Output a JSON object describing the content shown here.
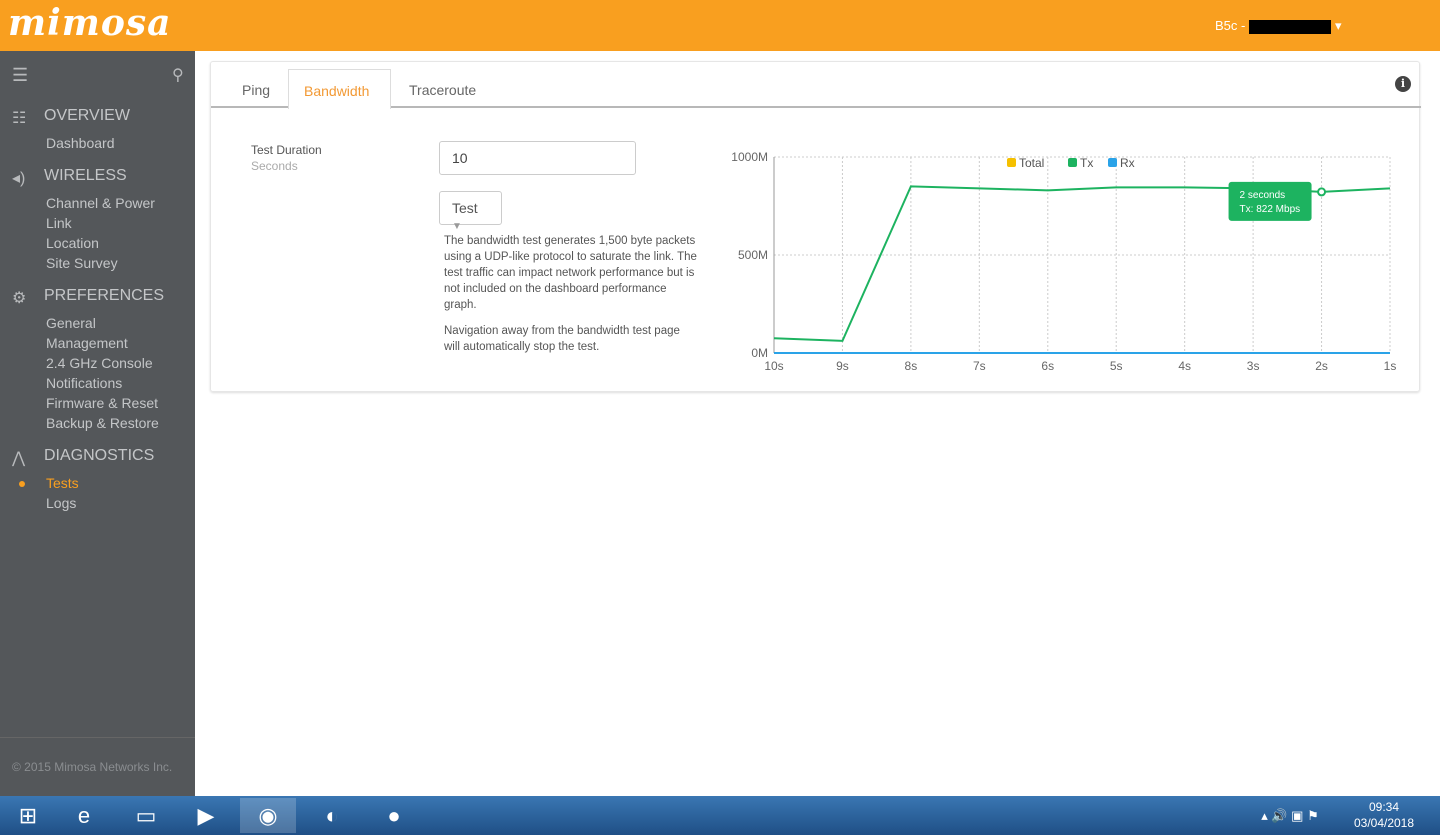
{
  "header": {
    "logo": "mimosa",
    "device": "B5c -"
  },
  "sidebar": {
    "sections": [
      {
        "title": "OVERVIEW",
        "items": [
          "Dashboard"
        ]
      },
      {
        "title": "WIRELESS",
        "items": [
          "Channel & Power",
          "Link",
          "Location",
          "Site Survey"
        ]
      },
      {
        "title": "PREFERENCES",
        "items": [
          "General",
          "Management",
          "2.4 GHz Console",
          "Notifications",
          "Firmware & Reset",
          "Backup & Restore"
        ]
      },
      {
        "title": "DIAGNOSTICS",
        "items": [
          "Tests",
          "Logs"
        ]
      }
    ],
    "active": "Tests",
    "footer": "© 2015 Mimosa Networks Inc."
  },
  "tabs": [
    "Ping",
    "Bandwidth",
    "Traceroute"
  ],
  "form": {
    "label": "Test Duration",
    "sublabel": "Seconds",
    "value": "10",
    "button": "Test",
    "desc1": "The bandwidth test generates 1,500 byte packets using a UDP-like protocol to saturate the link. The test traffic can impact network performance but is not included on the dashboard performance graph.",
    "desc2": "Navigation away from the bandwidth test page will automatically stop the test."
  },
  "chart_data": {
    "type": "line",
    "x": [
      "10s",
      "9s",
      "8s",
      "7s",
      "6s",
      "5s",
      "4s",
      "3s",
      "2s",
      "1s"
    ],
    "yticks": [
      "0M",
      "500M",
      "1000M"
    ],
    "ylim": [
      0,
      1000
    ],
    "legend": [
      "Total",
      "Tx",
      "Rx"
    ],
    "colors": {
      "Total": "#f5c000",
      "Tx": "#1db360",
      "Rx": "#2aa3e8"
    },
    "series": [
      {
        "name": "Tx",
        "values": [
          75,
          62,
          850,
          840,
          830,
          845,
          845,
          840,
          822,
          840
        ]
      },
      {
        "name": "Rx",
        "values": [
          0,
          0,
          0,
          0,
          0,
          0,
          0,
          0,
          0,
          0
        ]
      }
    ],
    "tooltip": {
      "title": "2 seconds",
      "text": "Tx: 822 Mbps"
    }
  },
  "taskbar": {
    "time": "09:34",
    "date": "03/04/2018"
  }
}
